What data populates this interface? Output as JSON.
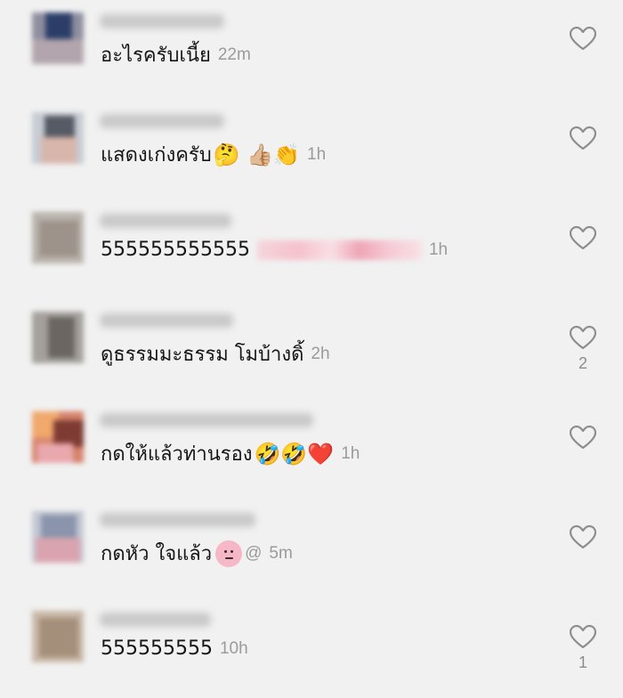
{
  "comments": [
    {
      "text": "อะไรครับเนี้ย",
      "emoji": "",
      "time": "22m",
      "likes": ""
    },
    {
      "text": "แสดงเก่งครับ",
      "emoji": "🤔 👍🏼👏",
      "time": "1h",
      "likes": ""
    },
    {
      "text": "555555555555",
      "emoji": "",
      "time": "1h",
      "likes": ""
    },
    {
      "text": "ดูธรรมมะธรรม โมบ้างดิ้",
      "emoji": "",
      "time": "2h",
      "likes": "2"
    },
    {
      "text": "กดให้แล้วท่านรอง",
      "emoji": "🤣🤣❤️",
      "time": "1h",
      "likes": ""
    },
    {
      "text": "กดหัว ใจแล้ว",
      "emoji": "",
      "suffix": "@",
      "time": "5m",
      "likes": ""
    },
    {
      "text": "555555555",
      "emoji": "",
      "time": "10h",
      "likes": "1"
    }
  ],
  "icons": {
    "like": "heart-outline-icon"
  },
  "colors": {
    "background": "#f1f1f1",
    "text": "#161616",
    "time": "#9b9b9b",
    "icon": "#8d8d8d"
  }
}
